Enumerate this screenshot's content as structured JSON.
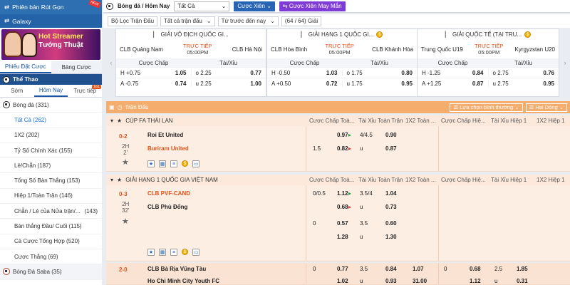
{
  "sidebar": {
    "top_item": "Phiên bản Rút Gọn",
    "top_badge": "NEW",
    "galaxy": "Galaxy",
    "banner_line1": "Hot Streamer",
    "banner_line2": "Tướng Thuật",
    "tabs": [
      "Phiếu Đặt Cược",
      "Bảng Cược"
    ],
    "sport_header": "Thể Thao",
    "date_tabs": [
      "Sớm",
      "Hôm Nay",
      "Trực tiếp"
    ],
    "live_count": "161",
    "football": "Bóng đá (331)",
    "items": [
      "Tất Cả (262)",
      "1X2 (202)",
      "Tỷ Số Chính Xác (155)",
      "Lẻ/Chẵn (187)",
      "Tổng Số Bàn Thắng (153)",
      "Hiệp 1/Toàn Trận (146)",
      "Chẵn / Lẻ của Nửa trận/...",
      "Bàn thắng Đầu/ Cuối (115)",
      "Cả Cược Tổng Hợp (520)",
      "Cược Thắng (69)"
    ],
    "item7_count": "(143)",
    "saba": "Bóng Đá Saba  (35)"
  },
  "topbar": {
    "breadcrumb": "Bóng đá / Hôm Nay",
    "select_value": "Tất Cả",
    "parlay_btn": "Cược Xiên",
    "lucky_btn": "Cược Xiên May Mắn"
  },
  "filters": {
    "league": "Bộ Lọc Trận Đấu",
    "bet_type": "Tất cả trận đấu",
    "time": "Từ trước đến nay",
    "count": "(64 / 64) Giải"
  },
  "cards": [
    {
      "league": "GIẢI VÔ ĐỊCH QUỐC GI...",
      "home": "CLB Quảng Nam",
      "away": "CLB Hà Nội",
      "status": "TRỰC TIẾP",
      "time": "05:00PM",
      "hdr1": "Cược Chấp",
      "hdr2": "Tài/Xỉu",
      "rows": [
        [
          "H",
          "+0.75",
          "1.05",
          "o",
          "2.25",
          "0.77"
        ],
        [
          "A",
          "-0.75",
          "0.74",
          "u",
          "2.25",
          "1.00"
        ]
      ]
    },
    {
      "league": "GIẢI HẠNG 1 QUỐC GI...",
      "home": "CLB Hòa Bình",
      "away": "CLB Khánh Hòa",
      "status": "TRỰC TIẾP",
      "time": "05:00PM",
      "hdr1": "Cược Chấp",
      "hdr2": "Tài/Xỉu",
      "rows": [
        [
          "H",
          "-0.50",
          "1.03",
          "o",
          "1.75",
          "0.80"
        ],
        [
          "A",
          "+0.50",
          "0.72",
          "u",
          "1.75",
          "0.95"
        ]
      ]
    },
    {
      "league": "GIẢI QUỐC TẾ (TẠI TRU...",
      "home": "Trung Quốc U19",
      "away": "Kyrgyzstan U20",
      "status": "TRỰC TIẾP",
      "time": "05:00PM",
      "hdr1": "Cược Chấp",
      "hdr2": "Tài/Xỉu",
      "rows": [
        [
          "H",
          "-1.25",
          "0.84",
          "o",
          "2.75",
          "0.76"
        ],
        [
          "A",
          "+1.25",
          "0.87",
          "u",
          "2.75",
          "0.95"
        ]
      ]
    }
  ],
  "table": {
    "title": "Trận Đấu",
    "sort_label": "Lựa chọn bình thường",
    "odds_label": "Hai Dòng",
    "cols": [
      "Cược Chấp Toà...",
      "Tài Xỉu Toàn Trận",
      "1X2 Toàn ...",
      "Cược Chấp Hiệ...",
      "Tài Xỉu Hiệp 1",
      "1X2 Hiệp 1"
    ],
    "leagues": [
      "CÚP FA THÁI LAN",
      "GIẢI HẠNG 1 QUỐC GIA VIỆT NAM"
    ],
    "matches": [
      {
        "score": "0-2",
        "half": "2H",
        "minute": "2'",
        "home": "Roi Et United",
        "away": "Buriram United",
        "odds": [
          [
            "",
            "0.97",
            "4/4.5",
            "0.90"
          ],
          [
            "1.5",
            "0.82",
            "u",
            "0.87"
          ]
        ]
      },
      {
        "score": "0-3",
        "half": "2H",
        "minute": "32'",
        "home": "CLB PVF-CAND",
        "away": "CLB Phù Đổng",
        "odds": [
          [
            "0/0.5",
            "1.12",
            "3.5/4",
            "1.04"
          ],
          [
            "",
            "0.68",
            "u",
            "0.73"
          ],
          [
            "0",
            "0.57",
            "3.5",
            "0.60"
          ],
          [
            "",
            "1.28",
            "u",
            "1.30"
          ]
        ]
      },
      {
        "score": "2-0",
        "home": "CLB Bà Rịa Vũng Tàu",
        "away": "Ho Chi Minh City Youth FC",
        "odds": [
          [
            "0",
            "0.77",
            "3.5",
            "0.84",
            "1.07",
            "0",
            "0.68",
            "2.5",
            "1.85"
          ],
          [
            "",
            "1.02",
            "u",
            "0.93",
            "31.00",
            "",
            "1.12",
            "u",
            "0.31"
          ]
        ]
      }
    ]
  }
}
